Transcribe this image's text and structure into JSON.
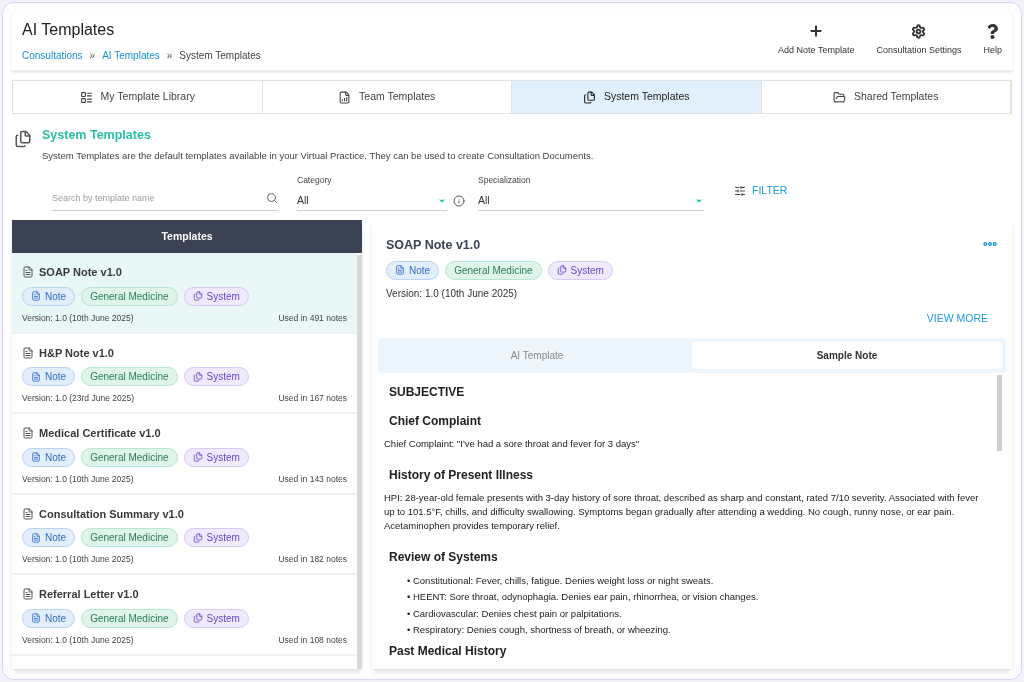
{
  "header": {
    "title": "AI Templates",
    "breadcrumbs": [
      {
        "label": "Consultations",
        "link": true
      },
      {
        "label": "AI Templates",
        "link": true
      },
      {
        "label": "System Templates",
        "link": false
      }
    ],
    "separator": "»",
    "actions": [
      {
        "label": "Add Note Template",
        "kind": "plus"
      },
      {
        "label": "Consultation Settings",
        "kind": "gear"
      },
      {
        "label": "Help",
        "kind": "help"
      }
    ]
  },
  "tabs": [
    {
      "label": "My Template Library",
      "selected": false
    },
    {
      "label": "Team Templates",
      "selected": false
    },
    {
      "label": "System Templates",
      "selected": true
    },
    {
      "label": "Shared Templates",
      "selected": false
    }
  ],
  "section": {
    "title": "System Templates",
    "description": "System Templates are the default templates available in your Virtual Practice. They can be used to create Consultation Documents."
  },
  "filters": {
    "search_placeholder": "Search by template name",
    "category": {
      "label": "Category",
      "value": "All"
    },
    "specialization": {
      "label": "Specialization",
      "value": "All"
    },
    "filter_button": "FILTER"
  },
  "templates_header": "Templates",
  "templates": [
    {
      "title": "SOAP Note v1.0",
      "selected": true,
      "tags": [
        {
          "label": "Note",
          "kind": "note"
        },
        {
          "label": "General Medicine",
          "kind": "specialty"
        },
        {
          "label": "System",
          "kind": "system"
        }
      ],
      "version": "Version: 1.0 (10th June 2025)",
      "usage": "Used in 491 notes"
    },
    {
      "title": "H&P Note v1.0",
      "selected": false,
      "tags": [
        {
          "label": "Note",
          "kind": "note"
        },
        {
          "label": "General Medicine",
          "kind": "specialty"
        },
        {
          "label": "System",
          "kind": "system"
        }
      ],
      "version": "Version: 1.0 (23rd June 2025)",
      "usage": "Used in 167 notes"
    },
    {
      "title": "Medical Certificate v1.0",
      "selected": false,
      "tags": [
        {
          "label": "Note",
          "kind": "note"
        },
        {
          "label": "General Medicine",
          "kind": "specialty"
        },
        {
          "label": "System",
          "kind": "system"
        }
      ],
      "version": "Version: 1.0 (10th June 2025)",
      "usage": "Used in 143 notes"
    },
    {
      "title": "Consultation Summary v1.0",
      "selected": false,
      "tags": [
        {
          "label": "Note",
          "kind": "note"
        },
        {
          "label": "General Medicine",
          "kind": "specialty"
        },
        {
          "label": "System",
          "kind": "system"
        }
      ],
      "version": "Version: 1.0 (10th June 2025)",
      "usage": "Used in 182 notes"
    },
    {
      "title": "Referral Letter v1.0",
      "selected": false,
      "tags": [
        {
          "label": "Note",
          "kind": "note"
        },
        {
          "label": "General Medicine",
          "kind": "specialty"
        },
        {
          "label": "System",
          "kind": "system"
        }
      ],
      "version": "Version: 1.0 (10th June 2025)",
      "usage": "Used in 108 notes"
    }
  ],
  "detail": {
    "title": "SOAP Note v1.0",
    "tags": [
      {
        "label": "Note",
        "kind": "note"
      },
      {
        "label": "General Medicine",
        "kind": "specialty"
      },
      {
        "label": "System",
        "kind": "system"
      }
    ],
    "version": "Version: 1.0 (10th June 2025)",
    "view_more": "VIEW MORE",
    "tabs": [
      {
        "label": "AI Template",
        "selected": false
      },
      {
        "label": "Sample Note",
        "selected": true
      }
    ],
    "content": [
      {
        "kind": "section",
        "text": "SUBJECTIVE"
      },
      {
        "kind": "heading",
        "text": "Chief Complaint"
      },
      {
        "kind": "paragraph",
        "text": "Chief Complaint: \"I've had a sore throat and fever for 3 days\""
      },
      {
        "kind": "heading",
        "text": "History of Present Illness"
      },
      {
        "kind": "paragraph",
        "text": "HPI: 28-year-old female presents with 3-day history of sore throat, described as sharp and constant, rated 7/10 severity. Associated with fever up to 101.5°F, chills, and difficulty swallowing. Symptoms began gradually after attending a wedding. No cough, runny nose, or ear pain. Acetaminophen provides temporary relief."
      },
      {
        "kind": "heading",
        "text": "Review of Systems"
      },
      {
        "kind": "bullet",
        "text": "• Constitutional: Fever, chills, fatigue. Denies weight loss or night sweats."
      },
      {
        "kind": "bullet",
        "text": "• HEENT: Sore throat, odynophagia. Denies ear pain, rhinorrhea, or vision changes."
      },
      {
        "kind": "bullet",
        "text": "• Cardiovascular: Denies chest pain or palpitations."
      },
      {
        "kind": "bullet",
        "text": "• Respiratory: Denies cough, shortness of breath, or wheezing."
      },
      {
        "kind": "heading",
        "text": "Past Medical History"
      }
    ]
  }
}
